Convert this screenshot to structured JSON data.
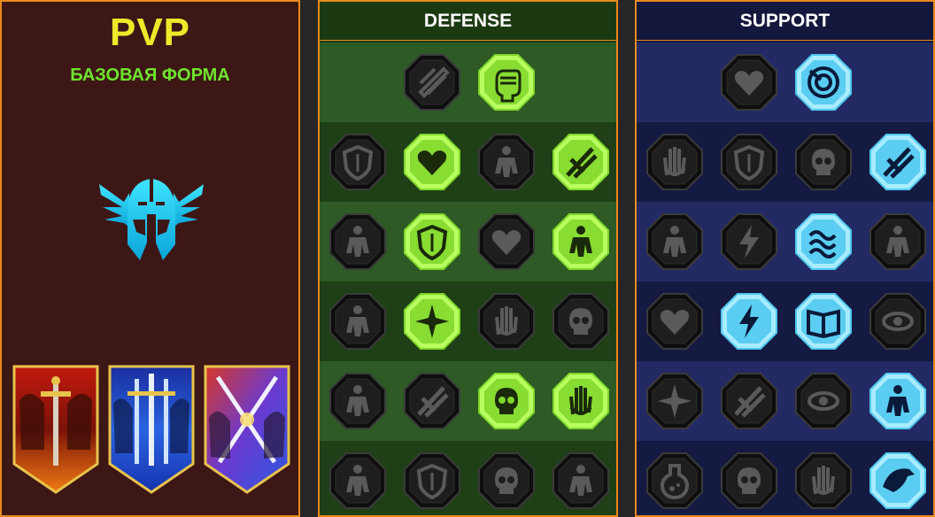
{
  "pvp_panel": {
    "title": "PVP",
    "subtitle": "БАЗОВАЯ ФОРМА",
    "accent_color": "#f0e82b",
    "subtitle_color": "#6fe42e",
    "emblem_icon": "winged-helmet-icon",
    "banners": [
      {
        "icon": "red-sword-banner-icon",
        "color": "#e0391c"
      },
      {
        "icon": "blue-sword-banner-icon",
        "color": "#2a63e0"
      },
      {
        "icon": "crossed-swords-banner-icon",
        "color": "#b040c0"
      }
    ]
  },
  "defense_tree": {
    "title": "DEFENSE",
    "active_color": "#7fd62a",
    "rows": [
      [
        {
          "icon": "brick-wall-icon",
          "active": false
        },
        {
          "icon": "raised-fist-icon",
          "active": true
        }
      ],
      [
        {
          "icon": "layered-shield-icon",
          "active": false
        },
        {
          "icon": "heart-organ-icon",
          "active": true
        },
        {
          "icon": "stone-golem-icon",
          "active": false
        },
        {
          "icon": "crossed-blades-icon",
          "active": true
        }
      ],
      [
        {
          "icon": "warrior-shadow-icon",
          "active": false
        },
        {
          "icon": "knight-shield-icon",
          "active": true
        },
        {
          "icon": "skull-heart-icon",
          "active": false
        },
        {
          "icon": "halo-figure-icon",
          "active": true
        }
      ],
      [
        {
          "icon": "crowd-icon",
          "active": false
        },
        {
          "icon": "hourglass-alien-icon",
          "active": true
        },
        {
          "icon": "open-palm-icon",
          "active": false
        },
        {
          "icon": "bull-head-icon",
          "active": false
        }
      ],
      [
        {
          "icon": "dash-runner-icon",
          "active": false
        },
        {
          "icon": "claw-marks-icon",
          "active": false
        },
        {
          "icon": "radiant-skull-icon",
          "active": true
        },
        {
          "icon": "healing-hand-icon",
          "active": true
        }
      ],
      [
        {
          "icon": "crowned-warrior-icon",
          "active": false
        },
        {
          "icon": "winged-shield-icon",
          "active": false
        },
        {
          "icon": "bearded-face-icon",
          "active": false
        },
        {
          "icon": "strongman-icon",
          "active": false
        }
      ]
    ]
  },
  "support_tree": {
    "title": "SUPPORT",
    "active_color": "#4ec8f0",
    "rows": [
      [
        {
          "icon": "heart-plus-icon",
          "active": false
        },
        {
          "icon": "swirl-target-icon",
          "active": true
        }
      ],
      [
        {
          "icon": "praying-hands-icon",
          "active": false
        },
        {
          "icon": "arched-shield-icon",
          "active": false
        },
        {
          "icon": "smoking-skull-icon",
          "active": false
        },
        {
          "icon": "arm-blast-icon",
          "active": true
        }
      ],
      [
        {
          "icon": "sparkle-figure-icon",
          "active": false
        },
        {
          "icon": "lightning-icon",
          "active": false
        },
        {
          "icon": "storm-waves-icon",
          "active": true
        },
        {
          "icon": "twin-figures-icon",
          "active": false
        }
      ],
      [
        {
          "icon": "chained-heart-icon",
          "active": false
        },
        {
          "icon": "meteor-icon",
          "active": true
        },
        {
          "icon": "open-book-icon",
          "active": true
        },
        {
          "icon": "angry-eyes-icon",
          "active": false
        }
      ],
      [
        {
          "icon": "compass-star-icon",
          "active": false
        },
        {
          "icon": "speed-boot-icon",
          "active": false
        },
        {
          "icon": "all-seeing-eye-icon",
          "active": false
        },
        {
          "icon": "voodoo-doll-icon",
          "active": true
        }
      ],
      [
        {
          "icon": "potion-flask-icon",
          "active": false
        },
        {
          "icon": "horned-skull-icon",
          "active": false
        },
        {
          "icon": "fist-crown-icon",
          "active": false
        },
        {
          "icon": "eagle-head-icon",
          "active": true
        }
      ]
    ]
  }
}
